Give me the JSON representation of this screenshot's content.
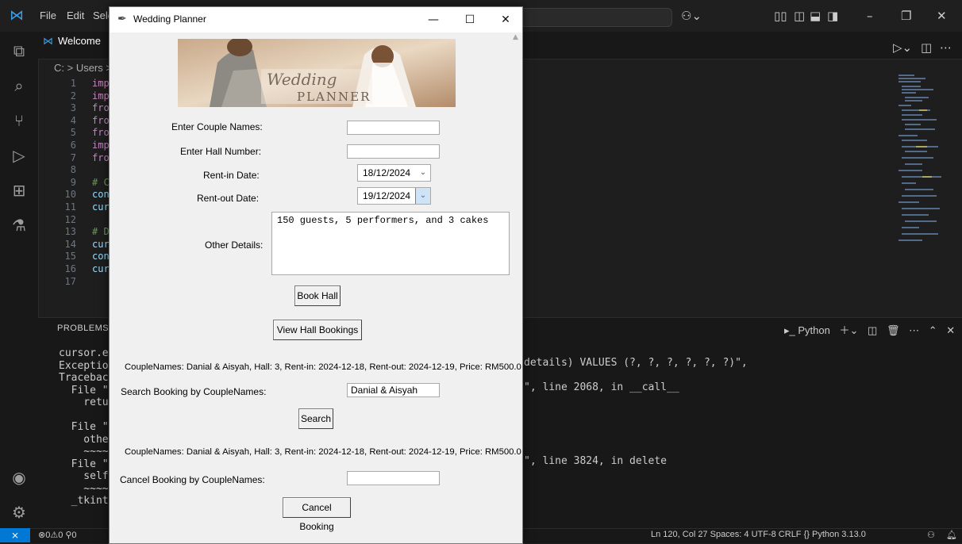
{
  "vscode": {
    "menu": [
      "File",
      "Edit",
      "Sele"
    ],
    "tab_welcome": "Welcome",
    "breadcrumb": "C: > Users >",
    "line_numbers": [
      "1",
      "2",
      "3",
      "4",
      "5",
      "6",
      "7",
      "8",
      "9",
      "10",
      "11",
      "12",
      "13",
      "14",
      "15",
      "16",
      "17"
    ],
    "code_fragments": [
      "imp",
      "imp",
      "fro",
      "fro",
      "fro",
      "imp",
      "fro",
      "",
      "# C",
      "con",
      "cur",
      "",
      "# D",
      "cur",
      "con",
      "cur",
      ""
    ],
    "panel_title": "PROBLEMS",
    "terminal_left": [
      "cursor.e",
      "Exception",
      "Traceback",
      "  File \"C:",
      "    return",
      "",
      "  File \"c:",
      "    otherc",
      "    ~~~~~~",
      "  File \"C:",
      "    self.t",
      "    ~~~~~~",
      "  _tkinter.T"
    ],
    "terminal_right": [
      {
        "line": 4,
        "text": "details) VALUES (?, ?, ?, ?, ?, ?)\","
      },
      {
        "line": 6,
        "text": "\", line 2068, in __call__"
      },
      {
        "line": 12,
        "text": "\", line 3824, in delete"
      }
    ],
    "panel_terminal_label": "Python",
    "status_left": "⊗0⚠0   ⚲0",
    "status_right": "Ln 120, Col 27   Spaces: 4   UTF-8   CRLF   {} Python   3.13.0"
  },
  "app": {
    "title": "Wedding Planner",
    "labels": {
      "couple_names": "Enter Couple Names:",
      "hall_number": "Enter Hall Number:",
      "rent_in": "Rent-in Date:",
      "rent_out": "Rent-out Date:",
      "other_details": "Other Details:",
      "search_by": "Search Booking by CoupleNames:",
      "cancel_by": "Cancel Booking by CoupleNames:"
    },
    "values": {
      "couple_names": "",
      "hall_number": "",
      "rent_in": "18/12/2024",
      "rent_out": "19/12/2024",
      "other_details": "150 guests, 5 performers, and 3 cakes",
      "search_query": "Danial & Aisyah",
      "cancel_query": ""
    },
    "buttons": {
      "book": "Book Hall",
      "view": "View Hall Bookings",
      "search": "Search",
      "cancel": "Cancel Booking"
    },
    "results": {
      "bookings": "CoupleNames: Danial & Aisyah, Hall: 3, Rent-in: 2024-12-18, Rent-out: 2024-12-19, Price: RM500.0",
      "search": "CoupleNames: Danial & Aisyah, Hall: 3, Rent-in: 2024-12-18, Rent-out: 2024-12-19, Price: RM500.0"
    },
    "banner": {
      "script": "Wedding",
      "word": "PLANNER"
    }
  }
}
